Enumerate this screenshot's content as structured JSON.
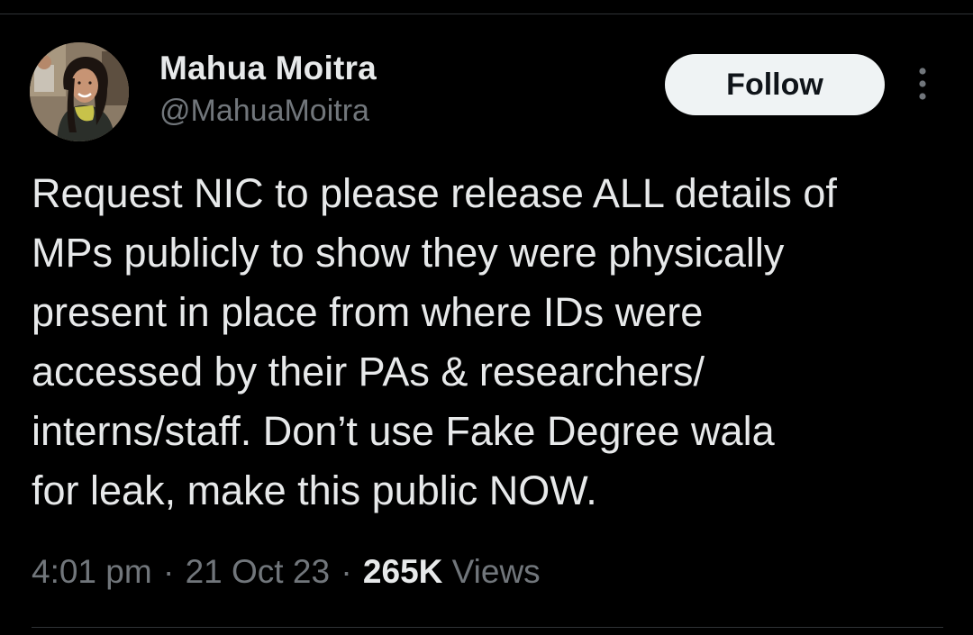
{
  "author": {
    "display_name": "Mahua Moitra",
    "handle": "@MahuaMoitra",
    "avatar_icon": "profile-photo"
  },
  "actions": {
    "follow_label": "Follow",
    "more_icon": "more-vertical-icon"
  },
  "tweet": {
    "text": "Request NIC to please release ALL details of\nMPs publicly to show they were physically\npresent in place from where IDs were\naccessed by their PAs & researchers/\ninterns/staff.  Don’t use Fake Degree wala\nfor leak, make this public NOW."
  },
  "meta": {
    "time": "4:01 pm",
    "separator": "·",
    "date": "21 Oct 23",
    "views_count": "265K",
    "views_label": "Views"
  },
  "colors": {
    "background": "#000000",
    "text_primary": "#e7e9ea",
    "text_secondary": "#71767b",
    "button_bg": "#eff3f4",
    "button_text": "#0f1419",
    "divider": "#2f3336"
  }
}
